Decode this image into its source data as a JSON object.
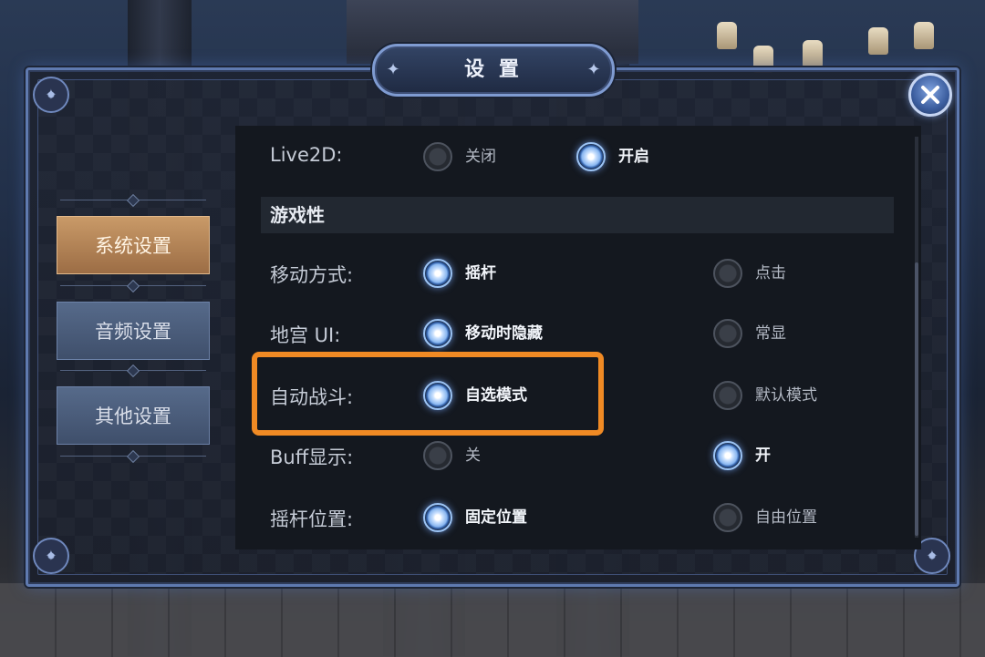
{
  "title": "设 置",
  "tabs": [
    {
      "label": "系统设置",
      "active": true
    },
    {
      "label": "音频设置",
      "active": false
    },
    {
      "label": "其他设置",
      "active": false
    }
  ],
  "live2d": {
    "label": "Live2D:",
    "options": [
      {
        "label": "关闭",
        "selected": false
      },
      {
        "label": "开启",
        "selected": true
      }
    ]
  },
  "section": {
    "title": "游戏性"
  },
  "settings": [
    {
      "label": "移动方式:",
      "options": [
        {
          "label": "摇杆",
          "selected": true
        },
        {
          "label": "点击",
          "selected": false
        }
      ]
    },
    {
      "label": "地宫 UI:",
      "options": [
        {
          "label": "移动时隐藏",
          "selected": true
        },
        {
          "label": "常显",
          "selected": false
        }
      ]
    },
    {
      "label": "自动战斗:",
      "options": [
        {
          "label": "自选模式",
          "selected": true
        },
        {
          "label": "默认模式",
          "selected": false
        }
      ]
    },
    {
      "label": "Buff显示:",
      "options": [
        {
          "label": "关",
          "selected": false
        },
        {
          "label": "开",
          "selected": true
        }
      ]
    },
    {
      "label": "摇杆位置:",
      "options": [
        {
          "label": "固定位置",
          "selected": true
        },
        {
          "label": "自由位置",
          "selected": false
        }
      ]
    }
  ],
  "colors": {
    "highlight": "#f08a24",
    "active_tab": "#c99a68",
    "frame": "#5f7ab0"
  },
  "icons": {
    "close": "close-x-icon",
    "corner": "star-ornament-icon"
  }
}
